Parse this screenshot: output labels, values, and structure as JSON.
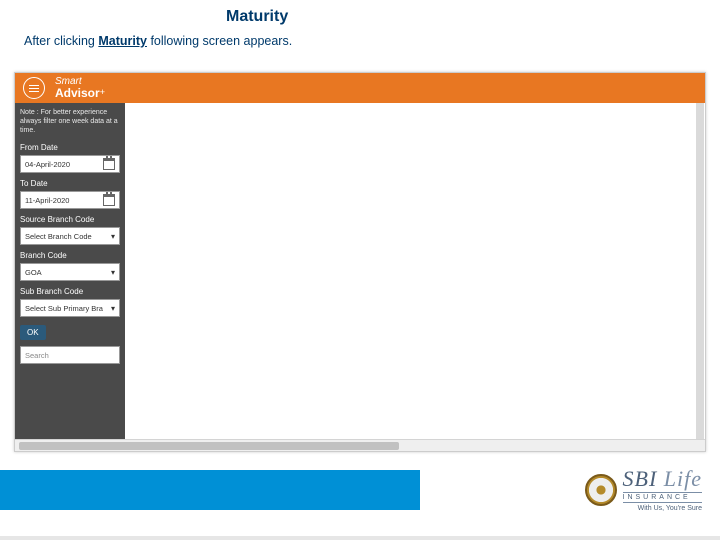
{
  "doc": {
    "title": "Maturity",
    "subtitle_pre": "After clicking ",
    "subtitle_bold": "Maturity",
    "subtitle_post": " following screen appears."
  },
  "app": {
    "brand_line1": "Smart",
    "brand_line2": "Advisor",
    "brand_plus": "+"
  },
  "sidebar": {
    "note": "Note : For better experience always filter one week data at a time.",
    "from_label": "From Date",
    "from_value": "04-April-2020",
    "to_label": "To Date",
    "to_value": "11-April-2020",
    "src_label": "Source Branch Code",
    "src_value": "Select Branch Code",
    "branch_label": "Branch Code",
    "branch_value": "GOA",
    "sub_label": "Sub Branch Code",
    "sub_value": "Select Sub Primary Bra",
    "ok_label": "OK",
    "search_placeholder": "Search"
  },
  "footer": {
    "brand_main": "SBI",
    "brand_life": " Life",
    "brand_sub": "INSURANCE",
    "brand_tag": "With Us, You're Sure"
  }
}
